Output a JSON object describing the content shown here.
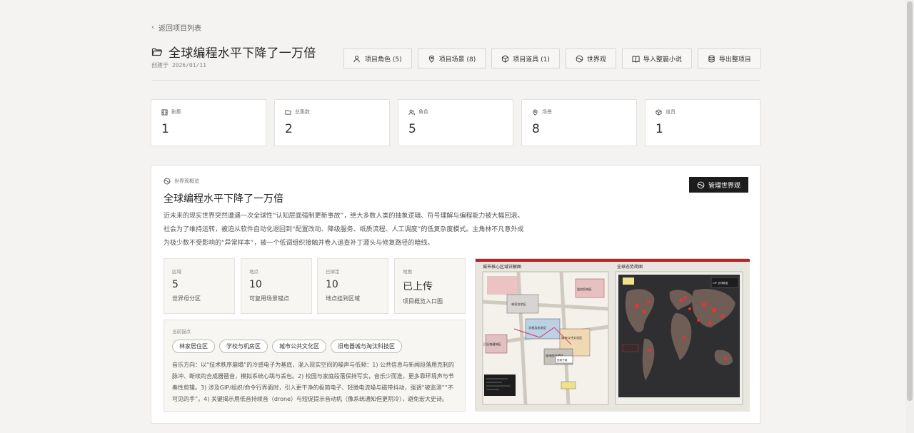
{
  "nav": {
    "back_label": "返回项目列表"
  },
  "project": {
    "title": "全球编程水平下降了一万倍",
    "created": "创建于 2026/01/11"
  },
  "actions": [
    {
      "label": "项目角色 (5)",
      "icon": "users-icon"
    },
    {
      "label": "项目场景 (8)",
      "icon": "map-pin-icon"
    },
    {
      "label": "项目道具 (1)",
      "icon": "box-icon"
    },
    {
      "label": "世界观",
      "icon": "globe-icon"
    },
    {
      "label": "导入整篇小说",
      "icon": "book-icon"
    },
    {
      "label": "导出整项目",
      "icon": "database-icon"
    }
  ],
  "stats": [
    {
      "label": "剧集",
      "value": "1",
      "icon": "film-icon"
    },
    {
      "label": "总集数",
      "value": "2",
      "icon": "folder-icon"
    },
    {
      "label": "角色",
      "value": "5",
      "icon": "users-icon"
    },
    {
      "label": "场景",
      "value": "8",
      "icon": "map-pin-icon"
    },
    {
      "label": "道具",
      "value": "1",
      "icon": "box-icon"
    }
  ],
  "world": {
    "section_label": "世界观概览",
    "title": "全球编程水平下降了一万倍",
    "manage_label": "管理世界观",
    "description": "近未来的现实世界突然遭遇一次全球性“认知层面强制更新事故”，绝大多数人类的抽象逻辑、符号理解与编程能力被大幅回滚。社会为了维持运转，被迫从软件自动化退回到“配置改动、降级服务、纸质流程、人工调度”的低复杂度模式。主角林不凡意外成为极少数不受影响的“异常样本”，被一个低调组织接触并卷入追查补丁源头与修复路径的暗线。",
    "cards": [
      {
        "label": "区域",
        "value": "5",
        "sub": "世界母分区"
      },
      {
        "label": "地点",
        "value": "10",
        "sub": "可复用场景锚点"
      },
      {
        "label": "已绑定",
        "value": "10",
        "sub": "地点挂到区域"
      },
      {
        "label": "地图",
        "value": "已上传",
        "sub": "项目概览入口图"
      }
    ],
    "anchors_label": "当前锚点",
    "anchors": [
      "林家居住区",
      "学校与机房区",
      "城市公共文化区",
      "旧电器城与淘汰科技区"
    ],
    "music": "音乐方向：以“技术秩序崩塌”的冷感电子为基底，混入现实空间的噪声与低频：1) 公共信息与新闻段落用克制的脉冲、断续的合成器琶音，模拟系统心跳与丢包。2) 校园与家庭段落保持写实，音乐少而准，更多靠环境声与节奏性剪辑。3) 涉及GIP/组织/命令行界面时，引入更干净的极简电子、轻微电流噪与磁带抖动，强调“被监测”“不可见的手”。4) 关键揭示用低音持续音（drone）与短促提示音动机（像系统通知但更阴冷），避免宏大史诗。"
  },
  "map": {
    "left_title": "城市核心区域详解图",
    "right_title": "全球态势简图",
    "districts": [
      "林家住宅区",
      "学校及机房区",
      "城市公共文化区",
      "城市图书馆区",
      "旧电器城区",
      "监控局域区",
      "旧电子城"
    ],
    "status": "GIP 全球覆盖"
  }
}
